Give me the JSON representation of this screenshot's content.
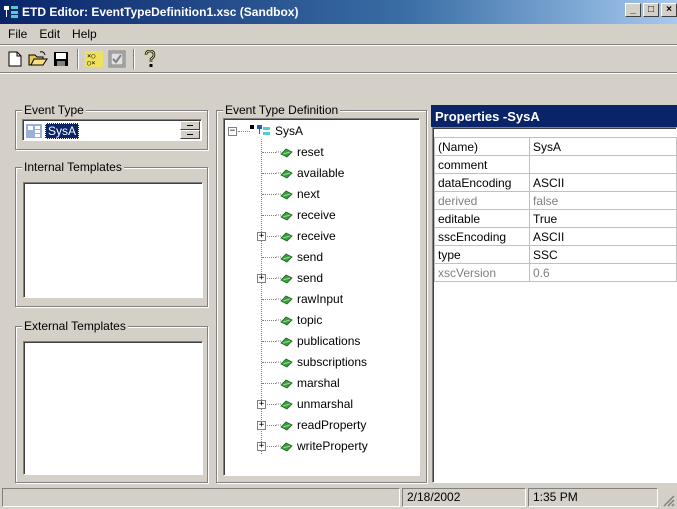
{
  "window": {
    "title": "ETD Editor: EventTypeDefinition1.xsc (Sandbox)",
    "buttons": {
      "minimize": "_",
      "maximize": "□",
      "close": "×"
    }
  },
  "menu": {
    "file": "File",
    "edit": "Edit",
    "help": "Help"
  },
  "toolbar": {
    "icons": [
      "new-file-icon",
      "open-folder-icon",
      "save-disk-icon",
      "grid-icon",
      "checkbox-icon",
      "help-question-icon"
    ]
  },
  "event_type": {
    "label": "Event Type",
    "selected": "SysA"
  },
  "internal_templates": {
    "label": "Internal Templates"
  },
  "external_templates": {
    "label": "External Templates"
  },
  "etd": {
    "label": "Event Type Definition",
    "root": "SysA",
    "nodes": [
      {
        "label": "reset",
        "expandable": false
      },
      {
        "label": "available",
        "expandable": false
      },
      {
        "label": "next",
        "expandable": false
      },
      {
        "label": "receive",
        "expandable": false
      },
      {
        "label": "receive",
        "expandable": true
      },
      {
        "label": "send",
        "expandable": false
      },
      {
        "label": "send",
        "expandable": true
      },
      {
        "label": "rawInput",
        "expandable": false
      },
      {
        "label": "topic",
        "expandable": false
      },
      {
        "label": "publications",
        "expandable": false
      },
      {
        "label": "subscriptions",
        "expandable": false
      },
      {
        "label": "marshal",
        "expandable": false
      },
      {
        "label": "unmarshal",
        "expandable": true
      },
      {
        "label": "readProperty",
        "expandable": true
      },
      {
        "label": "writeProperty",
        "expandable": true
      }
    ]
  },
  "properties": {
    "title": "Properties -SysA",
    "rows": [
      {
        "key": "(Name)",
        "value": "SysA",
        "disabled": false
      },
      {
        "key": "comment",
        "value": "",
        "disabled": false
      },
      {
        "key": "dataEncoding",
        "value": "ASCII",
        "disabled": false
      },
      {
        "key": "derived",
        "value": "false",
        "disabled": true
      },
      {
        "key": "editable",
        "value": "True",
        "disabled": false
      },
      {
        "key": "sscEncoding",
        "value": "ASCII",
        "disabled": false
      },
      {
        "key": "type",
        "value": "SSC",
        "disabled": false
      },
      {
        "key": "xscVersion",
        "value": "0.6",
        "disabled": true
      }
    ]
  },
  "status": {
    "message": "",
    "date": "2/18/2002",
    "time": "1:35 PM"
  },
  "colors": {
    "titlebar": "#0a246a",
    "face": "#d4d0c8",
    "leaf_green": "#3aa03a"
  }
}
